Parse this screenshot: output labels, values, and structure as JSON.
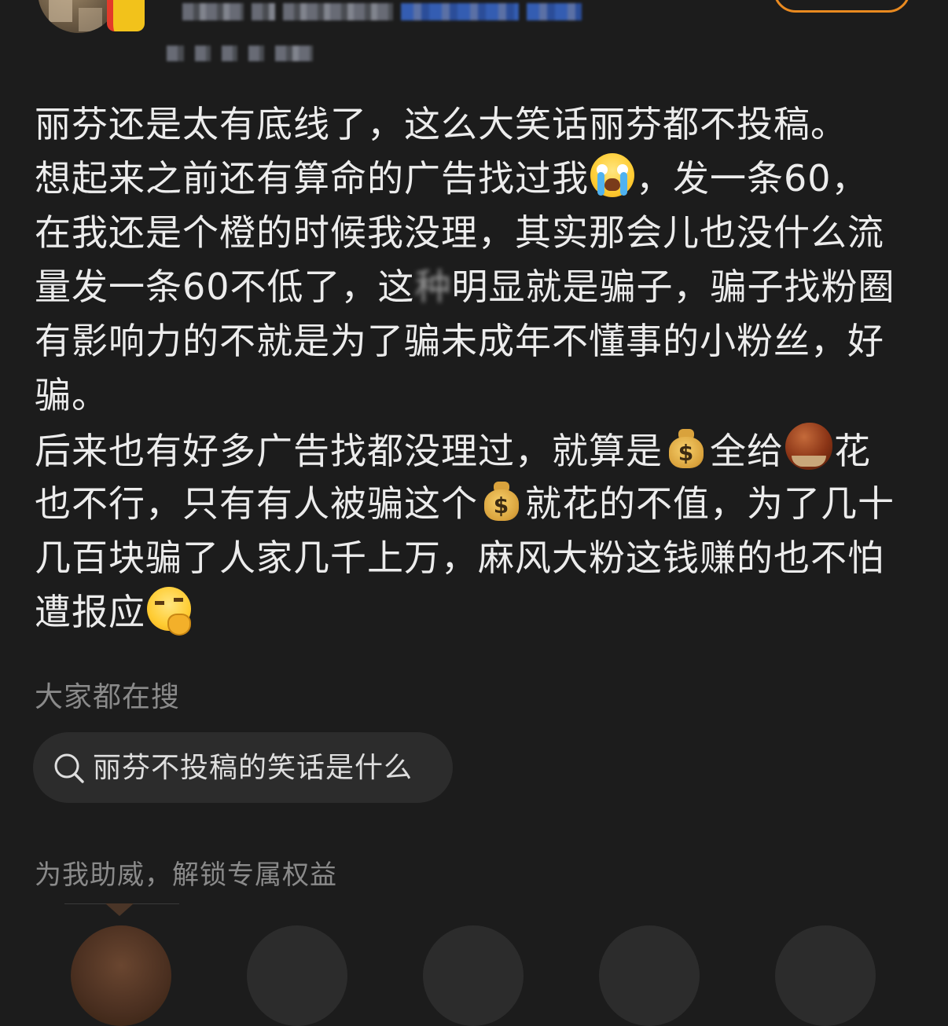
{
  "post": {
    "lines": [
      [
        "丽芬还是太有底线了，这么大笑话丽芬都不投稿。"
      ],
      [
        "想起来之前还有算命的广告找过我",
        {
          "emoji": "crying-face-icon"
        },
        "，发一条60，"
      ],
      [
        "在我还是个橙的时候我没理，其实那会儿也没什么流"
      ],
      [
        "量发一条60不低了，这",
        {
          "censored": "种"
        },
        "明显就是骗子，骗子找粉圈"
      ],
      [
        "有影响力的不就是为了骗未成年不懂事的小粉丝，好"
      ],
      [
        "骗。"
      ],
      [
        "后来也有好多广告找都没理过，就算是",
        {
          "emoji": "money-bag-icon"
        },
        "全给",
        {
          "emoji": "chestnut-icon"
        },
        "花"
      ],
      [
        "也不行，只有有人被骗这个",
        {
          "emoji": "money-bag-icon"
        },
        "就花的不值，为了几十"
      ],
      [
        "几百块骗了人家几千上万，麻风大粉这钱赚的也不怕"
      ],
      [
        "遭报应",
        {
          "emoji": "thinking-face-icon"
        }
      ]
    ]
  },
  "search": {
    "heading": "大家都在搜",
    "suggestion": "丽芬不投稿的笑话是什么"
  },
  "support": {
    "heading": "为我助威，解锁专属权益"
  },
  "colors": {
    "background": "#1c1c1c",
    "text": "#ececec",
    "muted": "#8a8a8a",
    "chip": "#2c2c2c",
    "follow_border": "#e98a20"
  }
}
